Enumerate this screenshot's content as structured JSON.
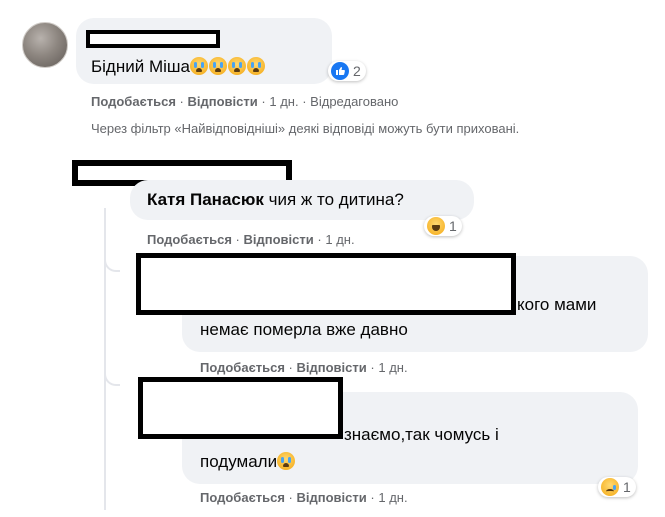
{
  "comment1": {
    "text": "Бідний Міша",
    "reaction_count": "2",
    "actions": {
      "like": "Подобається",
      "reply": "Відповісти",
      "time": "1 дн.",
      "edited": "Відредаговано"
    }
  },
  "filter_note": "Через фільтр «Найвідповідніші» деякі відповіді можуть бути приховані.",
  "reply1": {
    "author": "Катя Панасюк",
    "text": "чия ж то дитина?",
    "reaction_count": "1",
    "actions": {
      "like": "Подобається",
      "reply": "Відповісти",
      "time": "1 дн."
    }
  },
  "reply2": {
    "line1": "кого мами",
    "line2": "немає померла вже давно",
    "actions": {
      "like": "Подобається",
      "reply": "Відповісти",
      "time": "1 дн."
    }
  },
  "reply3": {
    "line1": "знаємо,так чомусь і",
    "line2": "подумали",
    "reaction_count": "1",
    "actions": {
      "like": "Подобається",
      "reply": "Відповісти",
      "time": "1 дн."
    }
  },
  "separator": "·",
  "colors": {
    "bubble": "#f0f2f5",
    "meta": "#65676b",
    "like_blue": "#1877f2"
  }
}
